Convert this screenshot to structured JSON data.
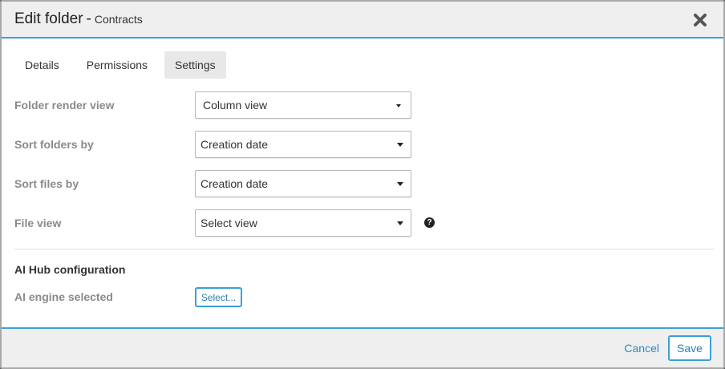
{
  "dialog": {
    "title": "Edit folder",
    "separator": "-",
    "subtitle": "Contracts"
  },
  "tabs": [
    {
      "label": "Details",
      "active": false
    },
    {
      "label": "Permissions",
      "active": false
    },
    {
      "label": "Settings",
      "active": true
    }
  ],
  "settings": {
    "folder_render_view": {
      "label": "Folder render view",
      "value": "Column view"
    },
    "sort_folders_by": {
      "label": "Sort folders by",
      "value": "Creation date"
    },
    "sort_files_by": {
      "label": "Sort files by",
      "value": "Creation date"
    },
    "file_view": {
      "label": "File view",
      "value": "Select view",
      "help": "?"
    }
  },
  "ai_hub": {
    "section_title": "AI Hub configuration",
    "engine_label": "AI engine selected",
    "select_button": "Select..."
  },
  "footer": {
    "cancel_label": "Cancel",
    "save_label": "Save"
  },
  "colors": {
    "accent": "#3aa0d6",
    "link": "#2a8ac4",
    "header_bg": "#efefef"
  }
}
